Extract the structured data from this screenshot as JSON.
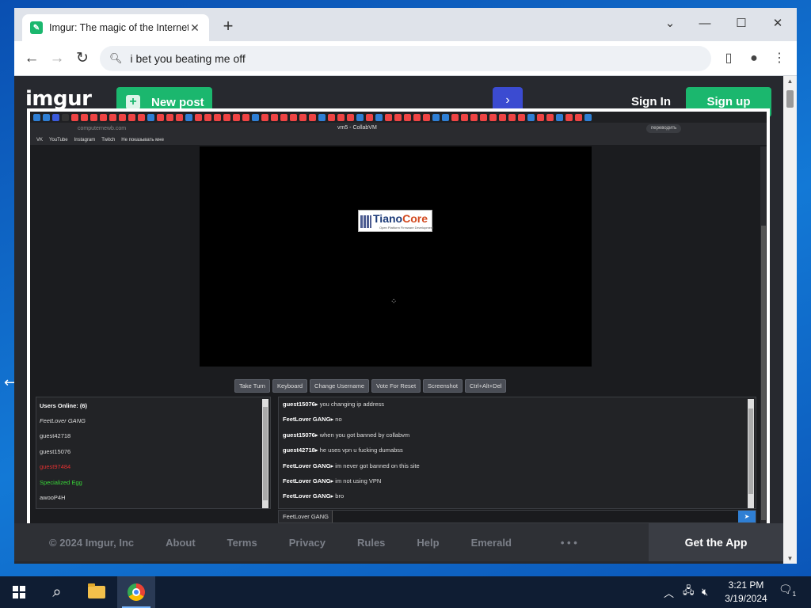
{
  "browser": {
    "tab_title": "Imgur: The magic of the Internet",
    "tab_close": "✕",
    "new_tab": "+",
    "address_value": "i bet you beating me off",
    "window_controls": {
      "dropdown": "⌄",
      "minimize": "—",
      "maximize": "☐",
      "close": "✕"
    }
  },
  "imgur": {
    "logo": "imgur",
    "new_post": "New post",
    "sign_in": "Sign In",
    "sign_up": "Sign up",
    "footer": {
      "copyright": "© 2024 Imgur, Inc",
      "links": [
        "About",
        "Terms",
        "Privacy",
        "Rules",
        "Help",
        "Emerald"
      ],
      "more": "• • •",
      "get_app": "Get the App"
    }
  },
  "embedded": {
    "bookmark_items": [
      "VK",
      "YouTube",
      "Instagram",
      "Twitch",
      "Не показывать мне"
    ],
    "url": "computernewb.com",
    "page_title": "vm5 - CollabVM",
    "translate_label": "переводить",
    "boot_logo_main": "Tiano",
    "boot_logo_accent": "Core",
    "boot_logo_sub": "Open Platform Firmware Development",
    "vm_buttons": [
      "Take Turn",
      "Keyboard",
      "Change Username",
      "Vote For Reset",
      "Screenshot",
      "Ctrl+Alt+Del"
    ],
    "users_header": "Users Online: (6)",
    "users": [
      {
        "name": "FeetLover GANG",
        "color": "#dddddd",
        "italic": true
      },
      {
        "name": "guest42718",
        "color": "#dddddd",
        "italic": false
      },
      {
        "name": "guest15076",
        "color": "#dddddd",
        "italic": false
      },
      {
        "name": "guest97484",
        "color": "#e03030",
        "italic": false
      },
      {
        "name": "Specialized Egg",
        "color": "#38d438",
        "italic": false
      },
      {
        "name": "awooP4H",
        "color": "#dddddd",
        "italic": false
      }
    ],
    "chat": [
      {
        "user": "guest15076",
        "text": "you changing ip address"
      },
      {
        "user": "FeetLover GANG",
        "text": "no"
      },
      {
        "user": "guest15076",
        "text": "when you got banned by collabvm"
      },
      {
        "user": "guest42718",
        "text": "he uses vpn u fucking dumabss"
      },
      {
        "user": "FeetLover GANG",
        "text": "im never got banned on this site"
      },
      {
        "user": "FeetLover GANG",
        "text": "im not using VPN"
      },
      {
        "user": "FeetLover GANG",
        "text": "bro"
      }
    ],
    "chat_username": "FeetLover GANG",
    "chat_input_value": ""
  },
  "taskbar": {
    "time": "3:21 PM",
    "date": "3/19/2024",
    "notification_count": "1"
  },
  "colors": {
    "imgur_green": "#1bb76e",
    "imgur_bg": "#27292f",
    "accent_blue": "#3b4bd1"
  }
}
